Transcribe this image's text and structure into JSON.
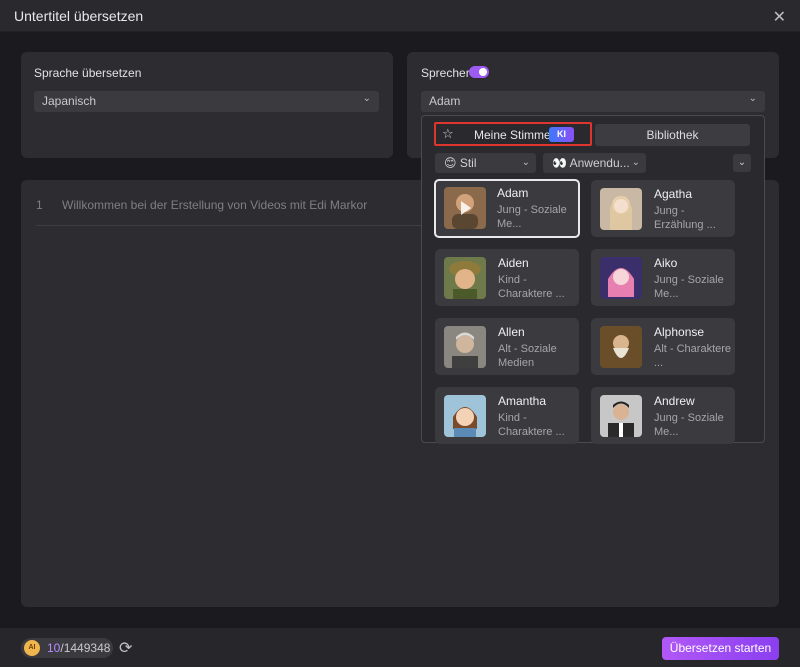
{
  "window": {
    "title": "Untertitel übersetzen",
    "close_icon": "close-icon"
  },
  "translate_panel": {
    "label": "Sprache übersetzen",
    "language_value": "Japanisch"
  },
  "speaker_panel": {
    "label": "Sprecher",
    "toggle_on": true,
    "speaker_value": "Adam"
  },
  "subtitles": [
    {
      "index": "1",
      "text": "Willkommen bei der Erstellung von Videos mit Edi Markor"
    }
  ],
  "voice_picker": {
    "tab_mine": "Meine Stimme",
    "tab_mine_badge": "KI",
    "tab_library": "Bibliothek",
    "filter_style": "😊 Stil",
    "filter_usage": "👀 Anwendu...",
    "voices": [
      {
        "name": "Adam",
        "desc": "Jung - Soziale Me...",
        "selected": true
      },
      {
        "name": "Agatha",
        "desc": "Jung - Erzählung ..."
      },
      {
        "name": "Aiden",
        "desc": "Kind - Charaktere ..."
      },
      {
        "name": "Aiko",
        "desc": "Jung - Soziale Me..."
      },
      {
        "name": "Allen",
        "desc": "Alt - Soziale Medien"
      },
      {
        "name": "Alphonse",
        "desc": "Alt - Charaktere ..."
      },
      {
        "name": "Amantha",
        "desc": "Kind - Charaktere ..."
      },
      {
        "name": "Andrew",
        "desc": "Jung - Soziale Me..."
      }
    ]
  },
  "footer": {
    "coin_label": "AI",
    "credits_used": "10",
    "credits_total": "/1449348",
    "start_button": "Übersetzen starten"
  },
  "colors": {
    "accent": "#9c5cf3",
    "highlight_border": "#e0342f",
    "background": "#1b1b1f",
    "panel": "#2d2d31"
  }
}
